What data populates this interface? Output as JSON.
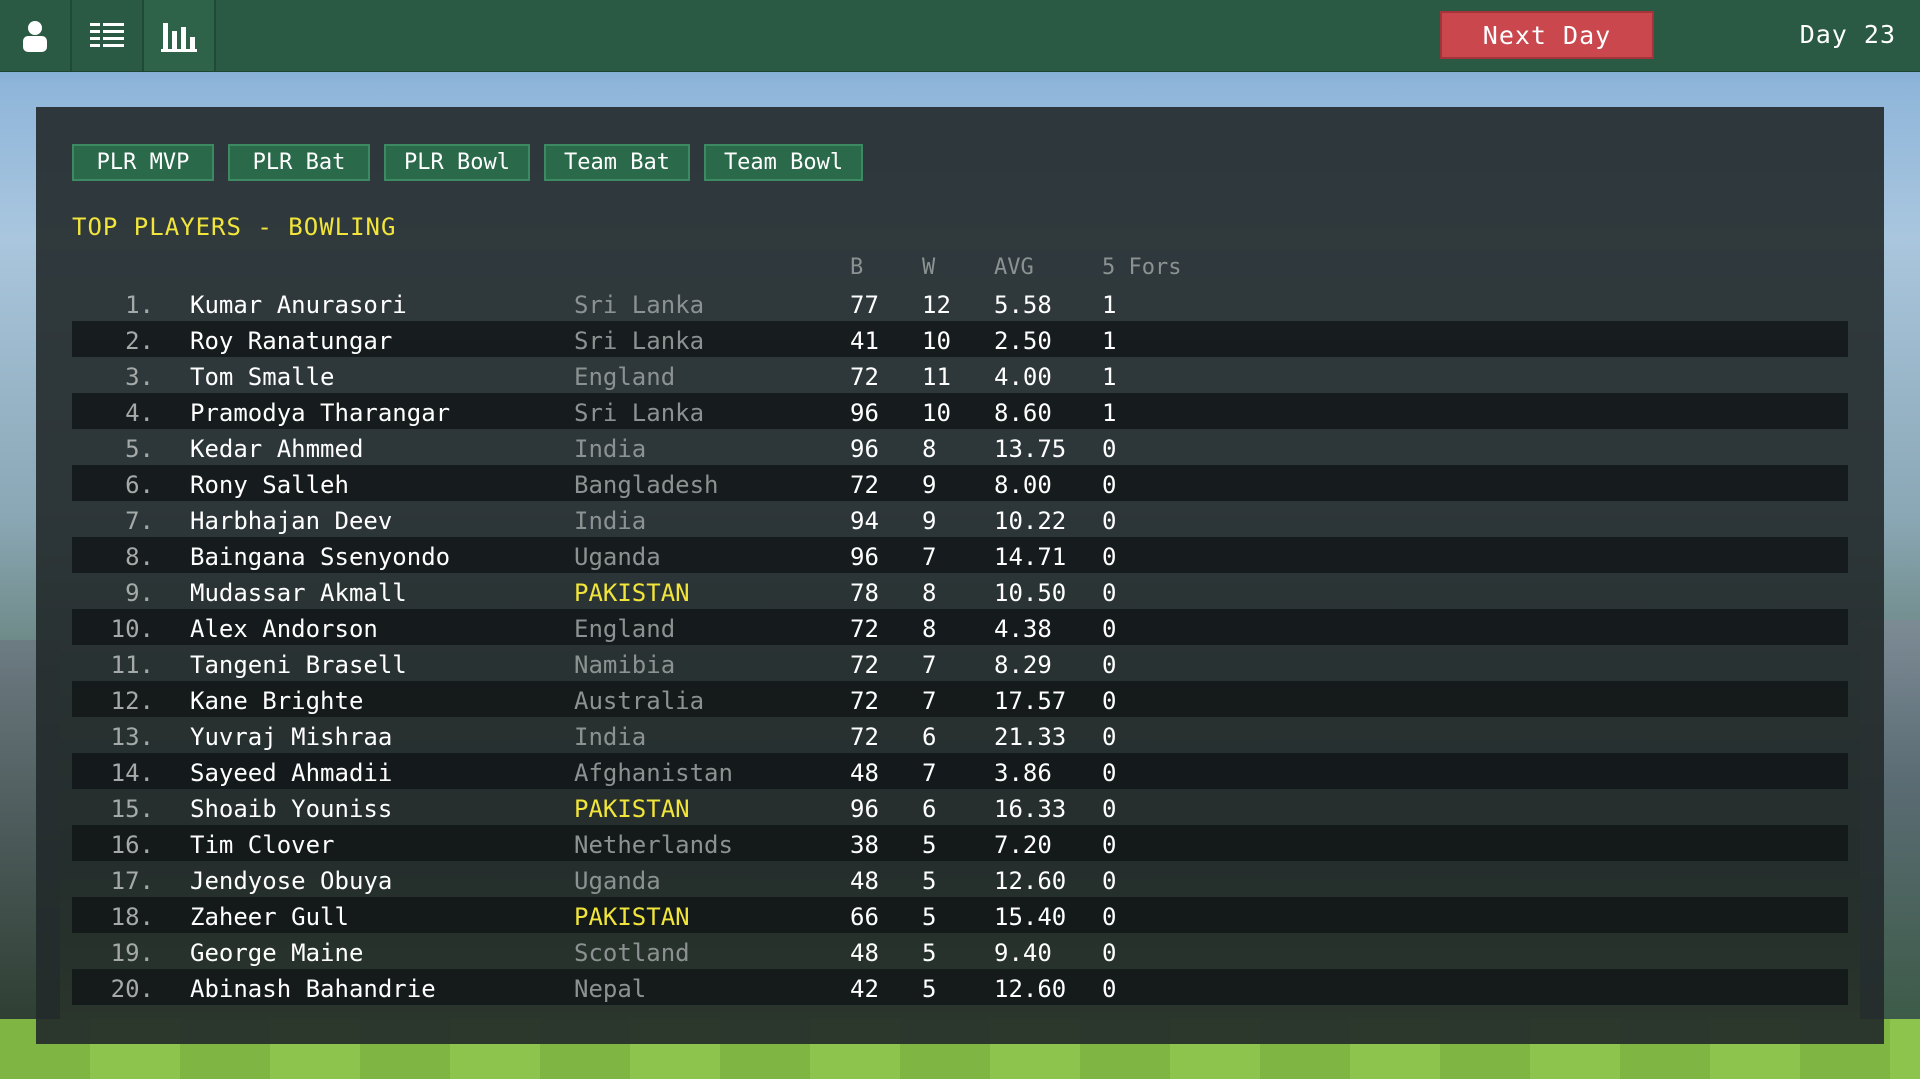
{
  "nav": {
    "icons": [
      "player-icon",
      "list-icon",
      "bar-chart-icon"
    ]
  },
  "topbar": {
    "next_day_label": "Next Day",
    "day_label": "Day 23"
  },
  "tabs": [
    {
      "label": "PLR MVP"
    },
    {
      "label": "PLR Bat"
    },
    {
      "label": "PLR Bowl"
    },
    {
      "label": "Team Bat"
    },
    {
      "label": "Team Bowl"
    }
  ],
  "section_title": "TOP PLAYERS - BOWLING",
  "columns": {
    "b": "B",
    "w": "W",
    "avg": "AVG",
    "five_fors": "5 Fors"
  },
  "highlight_color": "#f1e53b",
  "rows": [
    {
      "rank": "1.",
      "name": "Kumar Anurasori",
      "country": "Sri Lanka",
      "highlight": false,
      "b": "77",
      "w": "12",
      "avg": "5.58",
      "five_fors": "1"
    },
    {
      "rank": "2.",
      "name": "Roy Ranatungar",
      "country": "Sri Lanka",
      "highlight": false,
      "b": "41",
      "w": "10",
      "avg": "2.50",
      "five_fors": "1"
    },
    {
      "rank": "3.",
      "name": "Tom Smalle",
      "country": "England",
      "highlight": false,
      "b": "72",
      "w": "11",
      "avg": "4.00",
      "five_fors": "1"
    },
    {
      "rank": "4.",
      "name": "Pramodya Tharangar",
      "country": "Sri Lanka",
      "highlight": false,
      "b": "96",
      "w": "10",
      "avg": "8.60",
      "five_fors": "1"
    },
    {
      "rank": "5.",
      "name": "Kedar Ahmmed",
      "country": "India",
      "highlight": false,
      "b": "96",
      "w": "8",
      "avg": "13.75",
      "five_fors": "0"
    },
    {
      "rank": "6.",
      "name": "Rony Salleh",
      "country": "Bangladesh",
      "highlight": false,
      "b": "72",
      "w": "9",
      "avg": "8.00",
      "five_fors": "0"
    },
    {
      "rank": "7.",
      "name": "Harbhajan Deev",
      "country": "India",
      "highlight": false,
      "b": "94",
      "w": "9",
      "avg": "10.22",
      "five_fors": "0"
    },
    {
      "rank": "8.",
      "name": "Baingana Ssenyondo",
      "country": "Uganda",
      "highlight": false,
      "b": "96",
      "w": "7",
      "avg": "14.71",
      "five_fors": "0"
    },
    {
      "rank": "9.",
      "name": "Mudassar Akmall",
      "country": "PAKISTAN",
      "highlight": true,
      "b": "78",
      "w": "8",
      "avg": "10.50",
      "five_fors": "0"
    },
    {
      "rank": "10.",
      "name": "Alex Andorson",
      "country": "England",
      "highlight": false,
      "b": "72",
      "w": "8",
      "avg": "4.38",
      "five_fors": "0"
    },
    {
      "rank": "11.",
      "name": "Tangeni Brasell",
      "country": "Namibia",
      "highlight": false,
      "b": "72",
      "w": "7",
      "avg": "8.29",
      "five_fors": "0"
    },
    {
      "rank": "12.",
      "name": "Kane Brighte",
      "country": "Australia",
      "highlight": false,
      "b": "72",
      "w": "7",
      "avg": "17.57",
      "five_fors": "0"
    },
    {
      "rank": "13.",
      "name": "Yuvraj Mishraa",
      "country": "India",
      "highlight": false,
      "b": "72",
      "w": "6",
      "avg": "21.33",
      "five_fors": "0"
    },
    {
      "rank": "14.",
      "name": "Sayeed Ahmadii",
      "country": "Afghanistan",
      "highlight": false,
      "b": "48",
      "w": "7",
      "avg": "3.86",
      "five_fors": "0"
    },
    {
      "rank": "15.",
      "name": "Shoaib Youniss",
      "country": "PAKISTAN",
      "highlight": true,
      "b": "96",
      "w": "6",
      "avg": "16.33",
      "five_fors": "0"
    },
    {
      "rank": "16.",
      "name": "Tim Clover",
      "country": "Netherlands",
      "highlight": false,
      "b": "38",
      "w": "5",
      "avg": "7.20",
      "five_fors": "0"
    },
    {
      "rank": "17.",
      "name": "Jendyose Obuya",
      "country": "Uganda",
      "highlight": false,
      "b": "48",
      "w": "5",
      "avg": "12.60",
      "five_fors": "0"
    },
    {
      "rank": "18.",
      "name": "Zaheer Gull",
      "country": "PAKISTAN",
      "highlight": true,
      "b": "66",
      "w": "5",
      "avg": "15.40",
      "five_fors": "0"
    },
    {
      "rank": "19.",
      "name": "George Maine",
      "country": "Scotland",
      "highlight": false,
      "b": "48",
      "w": "5",
      "avg": "9.40",
      "five_fors": "0"
    },
    {
      "rank": "20.",
      "name": "Abinash Bahandrie",
      "country": "Nepal",
      "highlight": false,
      "b": "42",
      "w": "5",
      "avg": "12.60",
      "five_fors": "0"
    }
  ]
}
